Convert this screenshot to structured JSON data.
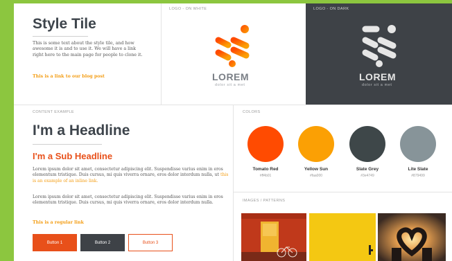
{
  "style_tile": {
    "title": "Style Tile",
    "description": "This is some text about the style tile, and how awesome it is and to use it. We will have a link right here to the main page for people to clone it.",
    "blog_link": "This is a link to our blog post"
  },
  "logos": {
    "white_label": "LOGO - ON WHITE",
    "dark_label": "LOGO - ON DARK",
    "wordmark": "LOREM",
    "tagline": "dolor sit a met"
  },
  "content": {
    "label": "CONTENT EXAMPLE",
    "headline": "I'm a Headline",
    "subheadline": "I'm a Sub Headline",
    "para1_text": "Lorem ipsum dolor sit amet, consectetur adipiscing elit. Suspendisse varius enim in eros elementum tristique. Duis cursus, mi quis viverra ornare, eros dolor interdum nulla, ut ",
    "para1_link": "this is an example of an inline link.",
    "para2": "Lorem ipsum dolor sit amet, consectetur adipiscing elit. Suspendisse varius enim in eros elementum tristique. Duis cursus, mi quis viverra ornare, eros dolor interdum nulla.",
    "regular_link": "This is a regular link",
    "button1": "Button 1",
    "button2": "Button 2",
    "button3": "Button 3"
  },
  "colors": {
    "label": "COLORS",
    "swatches": [
      {
        "name": "Tomato Red",
        "hex": "#ff4b01",
        "color": "#ff4b01"
      },
      {
        "name": "Yellow Sun",
        "hex": "#faa000",
        "color": "#fba004"
      },
      {
        "name": "Slate Grey",
        "hex": "#3e4749",
        "color": "#3e4749"
      },
      {
        "name": "Lite Slate",
        "hex": "#879499",
        "color": "#879499"
      }
    ]
  },
  "images": {
    "label": "IMAGES / PATTERNS"
  }
}
